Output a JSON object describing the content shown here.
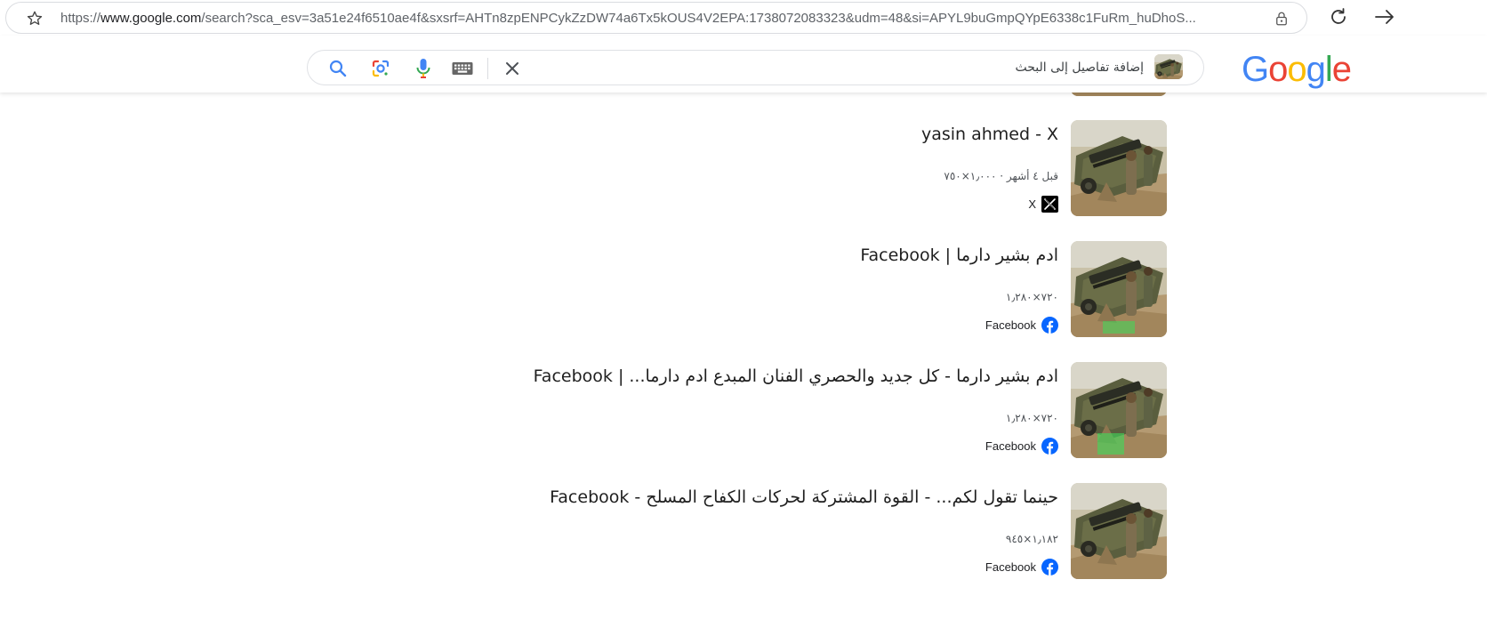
{
  "browser": {
    "url_prefix": "https://",
    "url_host": "www.google.com",
    "url_rest": "/search?sca_esv=3a51e24f6510ae4f&sxsrf=AHTn8zpENPCykZzDW74a6Tx5kOUS4V2EPA:1738072083323&udm=48&si=APYL9buGmpQYpE6338c1FuRm_huDhoS..."
  },
  "header": {
    "logo_letters": [
      "G",
      "o",
      "o",
      "g",
      "l",
      "e"
    ],
    "logo_colors": [
      "#4285F4",
      "#EA4335",
      "#FBBC05",
      "#4285F4",
      "#34A853",
      "#EA4335"
    ],
    "search_placeholder": "إضافة تفاصيل إلى البحث"
  },
  "results": [
    {
      "title": "yasin ahmed - X",
      "meta": "قبل ٤ أشهر · ١٫٠٠٠×٧٥٠",
      "source": "X",
      "source_icon": "x-logo-icon"
    },
    {
      "title": "ادم بشير دارما | Facebook",
      "meta": "٧٢٠×١٫٢٨٠",
      "source": "Facebook",
      "source_icon": "facebook-logo-icon"
    },
    {
      "title": "ادم بشير دارما - كل جديد والحصري الفنان المبدع ادم دارما... | Facebook",
      "meta": "٧٢٠×١٫٢٨٠",
      "source": "Facebook",
      "source_icon": "facebook-logo-icon"
    },
    {
      "title": "حينما تقول لكم... - القوة المشتركة لحركات الكفاح المسلح - Facebook",
      "meta": "١٫١٨٢×٩٤٥",
      "source": "Facebook",
      "source_icon": "facebook-logo-icon"
    }
  ],
  "colors": {
    "facebook_blue": "#0866FF",
    "x_black": "#000000",
    "google_blue": "#4285F4",
    "google_red": "#EA4335",
    "google_yellow": "#FBBC05",
    "google_green": "#34A853"
  }
}
